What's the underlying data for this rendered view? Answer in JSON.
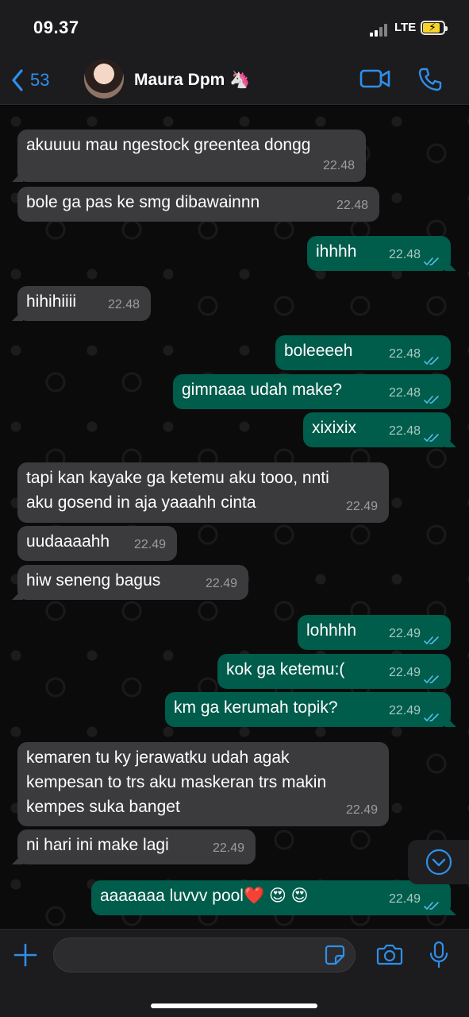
{
  "status_bar": {
    "time": "09.37",
    "network": "LTE"
  },
  "header": {
    "back_count": "53",
    "contact_name": "Maura Dpm 🦄"
  },
  "messages": [
    {
      "dir": "in",
      "text": "akuuuu mau ngestock greentea dongg",
      "time": "22.48"
    },
    {
      "dir": "in",
      "text": "bole ga pas ke smg dibawainnn",
      "time": "22.48"
    },
    {
      "dir": "out",
      "text": "ihhhh",
      "time": "22.48"
    },
    {
      "dir": "in",
      "text": "hihihiiii",
      "time": "22.48"
    },
    {
      "dir": "out",
      "text": "boleeeeh",
      "time": "22.48"
    },
    {
      "dir": "out",
      "text": "gimnaaa udah make?",
      "time": "22.48"
    },
    {
      "dir": "out",
      "text": "xixixix",
      "time": "22.48"
    },
    {
      "dir": "in",
      "text": "tapi kan kayake ga ketemu aku tooo, nnti\naku gosend in aja yaaahh cinta",
      "time": "22.49"
    },
    {
      "dir": "in",
      "text": "uudaaaahh",
      "time": "22.49"
    },
    {
      "dir": "in",
      "text": "hiw seneng bagus",
      "time": "22.49"
    },
    {
      "dir": "out",
      "text": "lohhhh",
      "time": "22.49"
    },
    {
      "dir": "out",
      "text": "kok ga ketemu:(",
      "time": "22.49"
    },
    {
      "dir": "out",
      "text": "km ga kerumah topik?",
      "time": "22.49"
    },
    {
      "dir": "in",
      "text": "kemaren tu ky jerawatku udah agak\nkempesan to trs aku maskeran trs makin\nkempes suka banget",
      "time": "22.49"
    },
    {
      "dir": "in",
      "text": "ni hari ini make lagi",
      "time": "22.49"
    },
    {
      "dir": "out",
      "text": "aaaaaaa luvvv pool❤️ 😍 😍",
      "time": "22.49"
    }
  ],
  "colors": {
    "accent": "#2f8fea",
    "bubble_in": "#3b3b3d",
    "bubble_out": "#005c4b",
    "read_ticks": "#53bdeb"
  }
}
